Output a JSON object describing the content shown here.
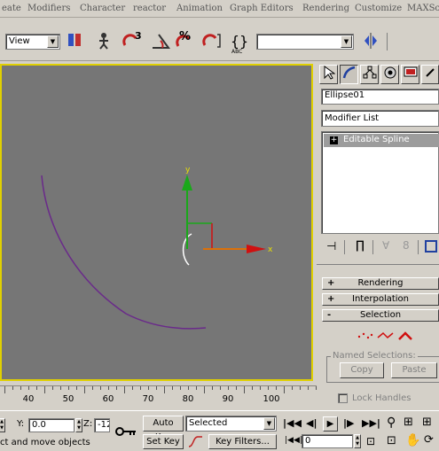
{
  "menu": [
    "eate",
    "Modifiers",
    "Character",
    "reactor",
    "Animation",
    "Graph Editors",
    "Rendering",
    "Customize",
    "MAXScr"
  ],
  "toolbar": {
    "view_select": "View",
    "selection_set": "",
    "snap_label": "3",
    "percent_label": "%",
    "abc_label": "ABC"
  },
  "command_panel": {
    "object_name": "Ellipse01",
    "modifier_list": "Modifier List",
    "stack_item": "Editable Spline",
    "rollouts": [
      {
        "sign": "+",
        "label": "Rendering"
      },
      {
        "sign": "+",
        "label": "Interpolation"
      },
      {
        "sign": "-",
        "label": "Selection"
      }
    ],
    "named_selections": "Named Selections:",
    "copy": "Copy",
    "paste": "Paste",
    "lock_handles": "Lock Handles"
  },
  "timeline": {
    "ticks": [
      "40",
      "50",
      "60",
      "70",
      "80",
      "90",
      "100"
    ]
  },
  "status": {
    "y_label": "Y:",
    "y_value": "0.0",
    "z_label": "Z:",
    "z_value": "-12",
    "prompt": "ct and move objects",
    "auto_key": "Auto Key",
    "set_key": "Set Key",
    "selected": "Selected",
    "key_filters": "Key Filters...",
    "frame": "0"
  },
  "colors": {
    "viewport_bg": "#767676",
    "active_border": "#e0d000",
    "spline": "#6a2a8a",
    "gizmo_y": "#1aa81a",
    "gizmo_x": "#d01010"
  }
}
